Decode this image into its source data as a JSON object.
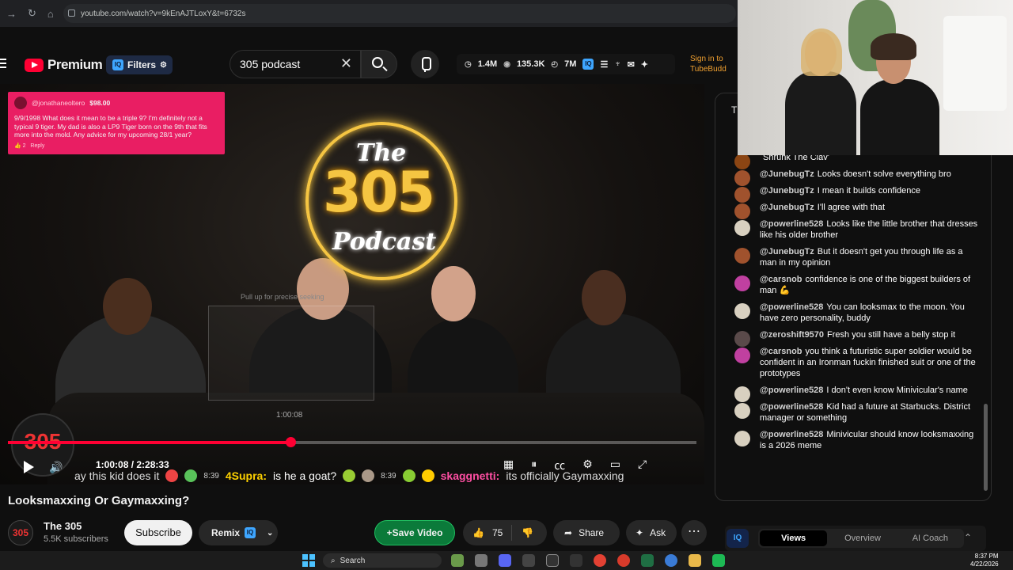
{
  "browser": {
    "url": "youtube.com/watch?v=9kEnAJTLoxY&t=6732s"
  },
  "header": {
    "brand": "Premium",
    "filters_label": "Filters",
    "search_value": "305 podcast",
    "stats": {
      "views": "1.4M",
      "eyes": "135.3K",
      "clock": "7M"
    },
    "signin": "Sign in to",
    "signin2": "TubeBudd"
  },
  "video": {
    "superchat": {
      "user": "@jonathaneoltero",
      "amount": "$98.00",
      "text": "9/9/1998 What does it mean to be a triple 9? I'm definitely not a typical 9 tiger. My dad is also a LP9 Tiger born on the 9th that fits more into the mold. Any advice for my upcoming 28/1 year?",
      "likes": "2",
      "reply": "Reply"
    },
    "neon": {
      "the": "The",
      "num": "305",
      "podcast": "Podcast"
    },
    "pullup": "Pull up for precise seeking",
    "preview_time": "1:00:08",
    "progress": 0.41,
    "time": "1:00:08 / 2:28:33",
    "ticker": {
      "msg1": "ay this kid does it",
      "ts1": "8:39",
      "who1": "4Supra:",
      "msg2": "is he a goat?",
      "ts2": "8:39",
      "who2": "skaggnetti:",
      "msg3": "its officially Gaymaxxing"
    }
  },
  "title": "Looksmaxxing Or Gaymaxxing?",
  "channel": {
    "name": "The 305",
    "subs": "5.5K subscribers",
    "avatar": "305"
  },
  "actions": {
    "subscribe": "Subscribe",
    "remix": "Remix",
    "save": "+Save Video",
    "likes": "75",
    "share": "Share",
    "ask": "Ask"
  },
  "chat": {
    "header_letter": "T",
    "messages": [
      {
        "author": "",
        "text": "Shrunk The Clav'",
        "color": "#8b4513"
      },
      {
        "author": "@JunebugTz",
        "text": "Looks doesn't solve everything bro",
        "color": "#a0522d"
      },
      {
        "author": "@JunebugTz",
        "text": "I mean it builds confidence",
        "color": "#a0522d"
      },
      {
        "author": "@JunebugTz",
        "text": "I'll agree with that",
        "color": "#a0522d"
      },
      {
        "author": "@powerline528",
        "text": "Looks like the little brother that dresses like his older brother",
        "color": "#d8d0c0"
      },
      {
        "author": "@JunebugTz",
        "text": "But it doesn't get you through life as a man in my opinion",
        "color": "#a0522d"
      },
      {
        "author": "@carsnob",
        "text": "confidence is one of the biggest builders of man 💪",
        "color": "#c040a0"
      },
      {
        "author": "@powerline528",
        "text": "You can looksmax to the moon. You have zero personality, buddy",
        "color": "#d8d0c0"
      },
      {
        "author": "@zeroshift9570",
        "text": "Fresh you still have a belly stop it",
        "color": "#5a4a4a"
      },
      {
        "author": "@carsnob",
        "text": "you think a futuristic super soldier would be confident in an Ironman fuckin finished suit or one of the prototypes",
        "color": "#c040a0"
      },
      {
        "author": "@powerline528",
        "text": "I don't even know Minivicular's name",
        "color": "#d8d0c0"
      },
      {
        "author": "@powerline528",
        "text": "Kid had a future at Starbucks. District manager or something",
        "color": "#d8d0c0"
      },
      {
        "author": "@powerline528",
        "text": "Minivicular should know looksmaxxing is a 2026 meme",
        "color": "#d8d0c0"
      }
    ]
  },
  "bottomtabs": {
    "iq": "IQ",
    "views": "Views",
    "overview": "Overview",
    "coach": "AI Coach"
  },
  "taskbar": {
    "search": "Search",
    "time": "8:37 PM",
    "date": "4/22/2026"
  },
  "webcam": {
    "overlay": "0"
  }
}
